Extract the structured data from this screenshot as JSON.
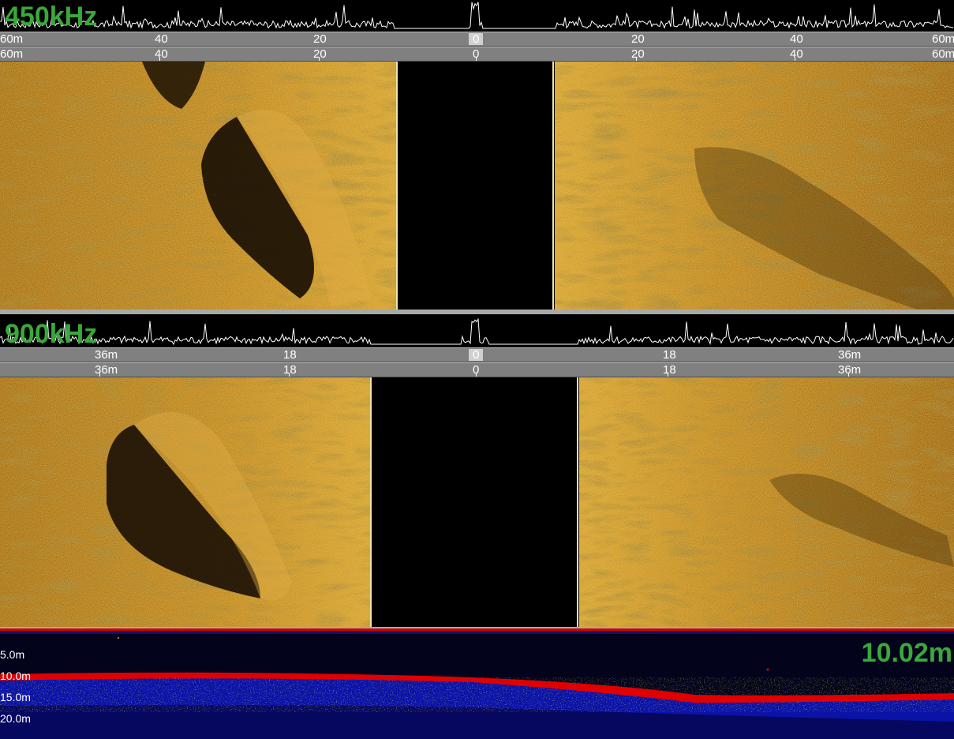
{
  "panels": [
    {
      "frequency_label": "450kHz",
      "scale_rows": [
        [
          {
            "text": "60m"
          },
          {
            "text": "40"
          },
          {
            "text": "20"
          },
          {
            "text": "0"
          },
          {
            "text": "20"
          },
          {
            "text": "40"
          },
          {
            "text": "60m"
          }
        ],
        [
          {
            "text": "60m"
          },
          {
            "text": "40"
          },
          {
            "text": "20"
          },
          {
            "text": "0"
          },
          {
            "text": "20"
          },
          {
            "text": "40"
          },
          {
            "text": "60m"
          }
        ]
      ]
    },
    {
      "frequency_label": "900kHz",
      "scale_rows": [
        [
          {
            "text": "36m"
          },
          {
            "text": "18"
          },
          {
            "text": "0"
          },
          {
            "text": "18"
          },
          {
            "text": "36m"
          }
        ],
        [
          {
            "text": "36m"
          },
          {
            "text": "18"
          },
          {
            "text": "0"
          },
          {
            "text": "18"
          },
          {
            "text": "36m"
          }
        ]
      ]
    }
  ],
  "echogram": {
    "depth_ticks": [
      "5.0m",
      "10.0m",
      "15.0m",
      "20.0m"
    ],
    "depth_readout": "10.02m"
  },
  "colors": {
    "frequency_label": "#3aa83a",
    "sonar_gold": "#c8961e",
    "scale_bar": "#808080",
    "echo_bottom": "#e00000",
    "echo_background": "#03041c"
  }
}
